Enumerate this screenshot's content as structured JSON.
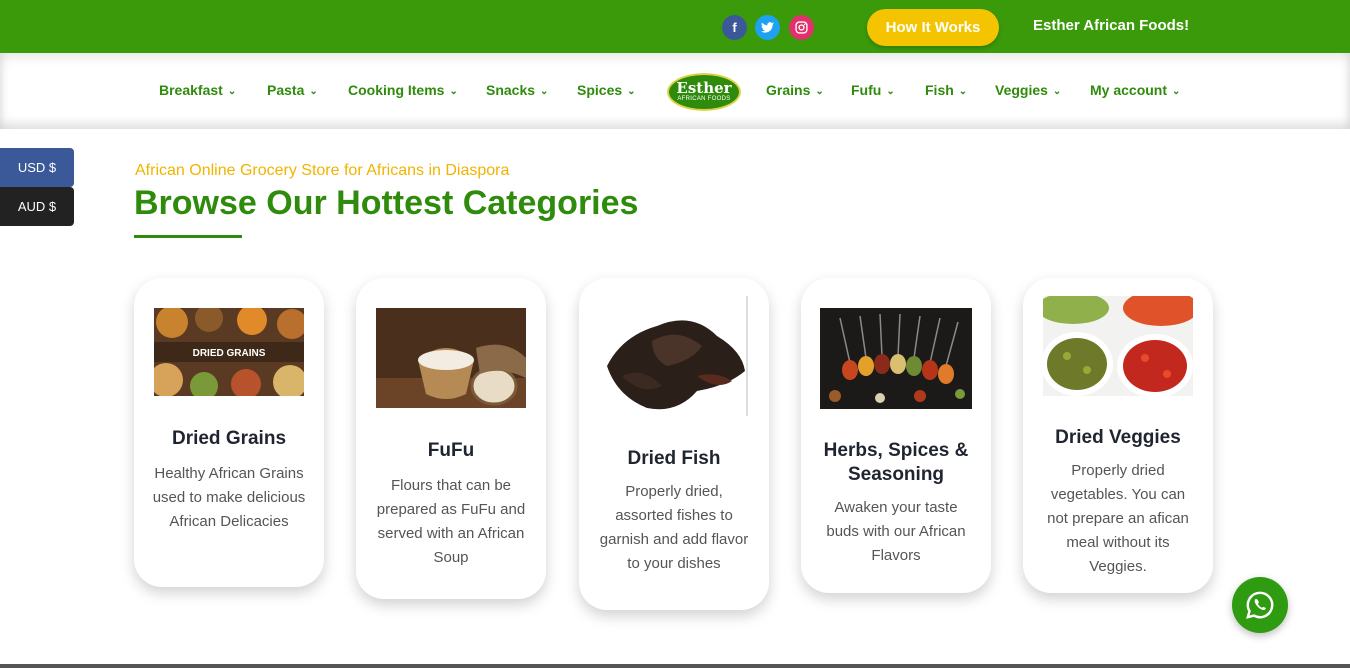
{
  "topbar": {
    "social": [
      "facebook-icon",
      "twitter-icon",
      "instagram-icon"
    ],
    "how_it_works": "How It Works",
    "brand": "Esther African Foods!"
  },
  "nav": {
    "items_left": [
      "Breakfast",
      "Pasta",
      "Cooking Items",
      "Snacks",
      "Spices"
    ],
    "logo_text": "Esther",
    "logo_sub": "AFRICAN FOODS",
    "items_right": [
      "Grains",
      "Fufu",
      "Fish",
      "Veggies",
      "My account"
    ]
  },
  "currency": {
    "usd": "USD $",
    "aud": "AUD $"
  },
  "hero": {
    "eyebrow": "African Online Grocery Store for Africans in Diaspora",
    "title": "Browse Our Hottest Categories"
  },
  "cards": [
    {
      "title": "Dried Grains",
      "desc": "Healthy African Grains used to make delicious African Delicacies",
      "image_label": "DRIED GRAINS"
    },
    {
      "title": "FuFu",
      "desc": "Flours that can be prepared as FuFu and served with  an African Soup"
    },
    {
      "title": "Dried Fish",
      "desc": "Properly dried, assorted fishes to garnish and add flavor to your dishes"
    },
    {
      "title": "Herbs, Spices & Seasoning",
      "desc": "Awaken your taste buds with our African Flavors"
    },
    {
      "title": "Dried Veggies",
      "desc": "Properly dried vegetables. You can not prepare an afican meal without its Veggies."
    }
  ],
  "colors": {
    "green": "#3b9a0a",
    "yellow": "#f5c400",
    "dark_text": "#1f2530"
  }
}
